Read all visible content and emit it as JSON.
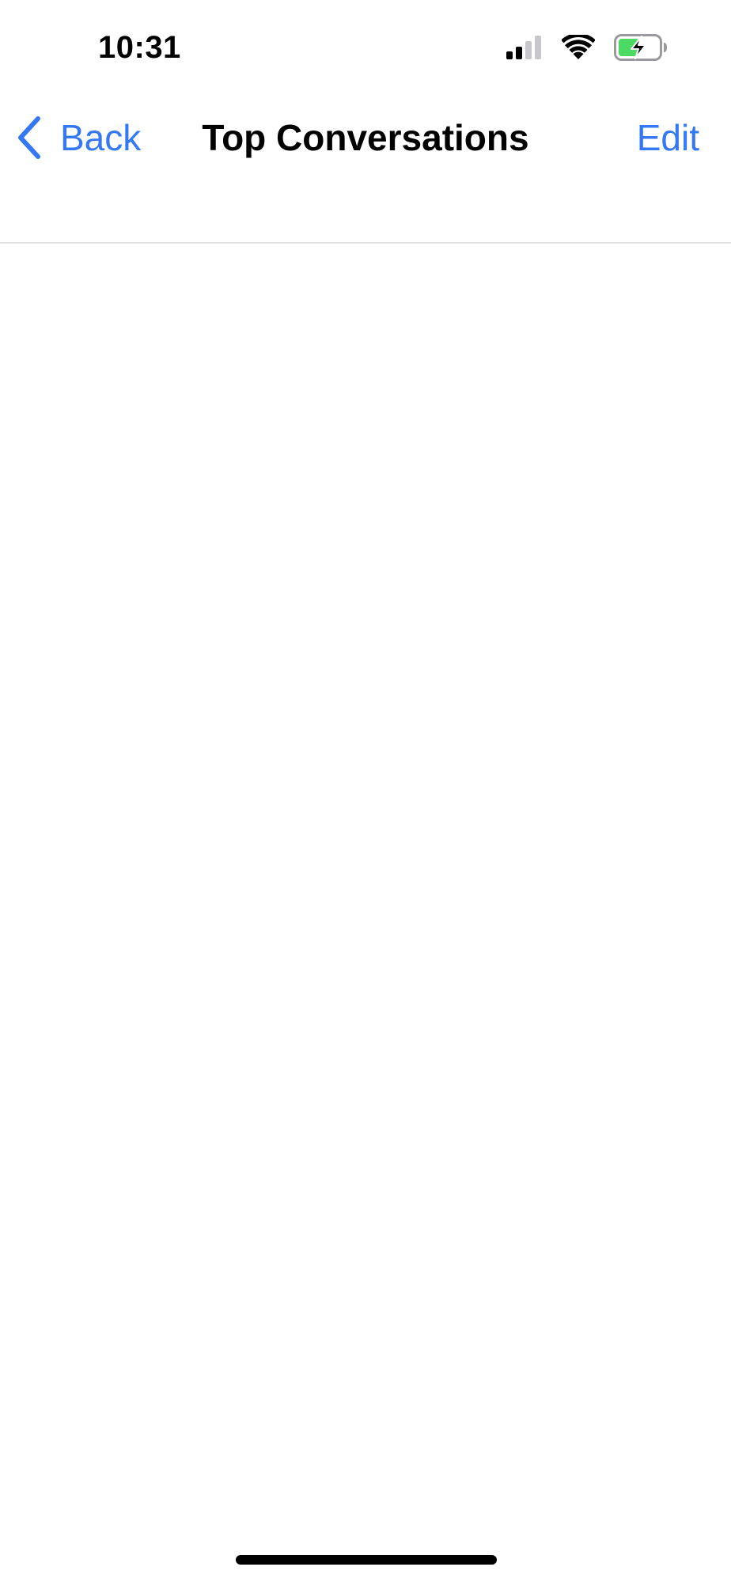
{
  "status_bar": {
    "time": "10:31",
    "icons": [
      "cellular-signal-icon",
      "wifi-icon",
      "battery-charging-icon"
    ],
    "battery_color": "#4cd964"
  },
  "nav": {
    "back_label": "Back",
    "title": "Top Conversations",
    "edit_label": "Edit"
  },
  "colors": {
    "accent": "#3478f6",
    "separator": "#e3e3e6"
  }
}
